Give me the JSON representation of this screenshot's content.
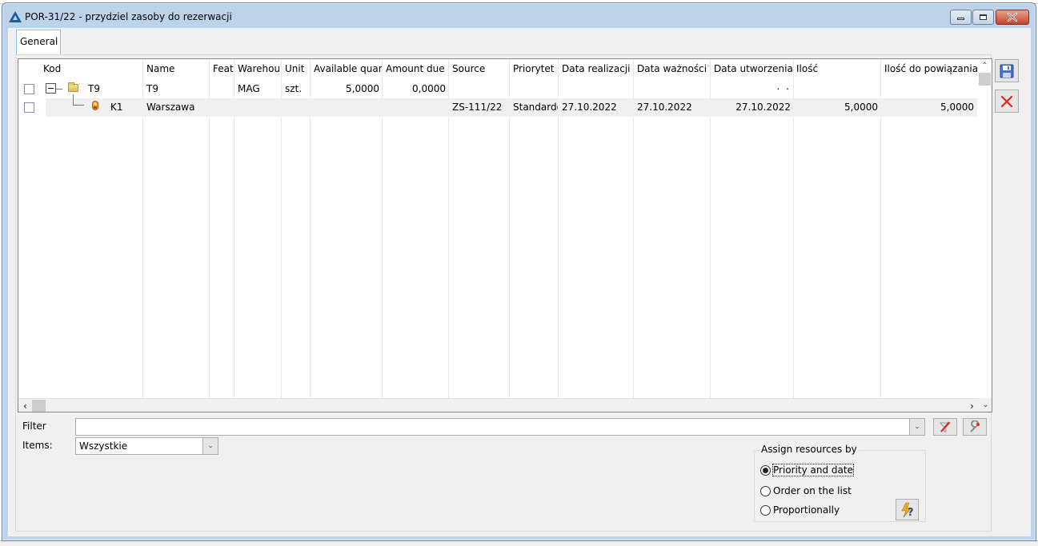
{
  "window": {
    "title": "POR-31/22 - przydziel zasoby do rezerwacji",
    "app_icon": "comarch-triangle-icon",
    "controls": [
      "minimize",
      "maximize",
      "close"
    ]
  },
  "tabs": [
    {
      "label": "General",
      "active": true
    }
  ],
  "grid": {
    "columns": [
      {
        "key": "kod",
        "label": "Kod"
      },
      {
        "key": "name",
        "label": "Name"
      },
      {
        "key": "feat",
        "label": "Feat"
      },
      {
        "key": "warehouse",
        "label": "Warehou"
      },
      {
        "key": "unit",
        "label": "Unit"
      },
      {
        "key": "available",
        "label": "Available quan"
      },
      {
        "key": "amount_due",
        "label": "Amount due"
      },
      {
        "key": "source",
        "label": "Source"
      },
      {
        "key": "priority",
        "label": "Priorytet"
      },
      {
        "key": "data_realizacji",
        "label": "Data realizacji"
      },
      {
        "key": "data_waznosci",
        "label": "Data ważności"
      },
      {
        "key": "data_utworzenia",
        "label": "Data utworzenia"
      },
      {
        "key": "ilosc",
        "label": "Ilość"
      },
      {
        "key": "ilosc_do_powiazania",
        "label": "Ilość do powiązania"
      }
    ],
    "rows": [
      {
        "checked": false,
        "level": 0,
        "icon": "folder-icon",
        "expanded": true,
        "kod": "T9",
        "name": "T9",
        "feat": "",
        "warehouse": "MAG",
        "unit": "szt.",
        "available": "5,0000",
        "amount_due": "0,0000",
        "source": "",
        "priority": "",
        "data_realizacji": "",
        "data_waznosci": "",
        "data_utworzenia": ". .",
        "ilosc": "",
        "ilosc_do_powiazania": ""
      },
      {
        "checked": false,
        "level": 1,
        "icon": "customer-icon",
        "selected": true,
        "kod": "K1",
        "name": "Warszawa",
        "feat": "",
        "warehouse": "",
        "unit": "",
        "available": "",
        "amount_due": "",
        "source": "ZS-111/22",
        "priority": "Standardo",
        "data_realizacji": "27.10.2022",
        "data_waznosci": "27.10.2022",
        "data_utworzenia": "27.10.2022",
        "ilosc": "5,0000",
        "ilosc_do_powiazania": "5,0000"
      }
    ]
  },
  "filter": {
    "label": "Filter",
    "value": "",
    "placeholder": ""
  },
  "items": {
    "label": "Items:",
    "selected": "Wszystkie"
  },
  "filter_buttons": [
    {
      "name": "clear-filter",
      "icon": "funnel-strike-icon"
    },
    {
      "name": "filter-builder",
      "icon": "wrench-icon"
    }
  ],
  "assign": {
    "legend": "Assign resources by",
    "options": [
      {
        "label": "Priority and date",
        "selected": true
      },
      {
        "label": "Order on the list",
        "selected": false
      },
      {
        "label": "Proportionally",
        "selected": false
      }
    ],
    "run_button_icon": "lightning-question-icon"
  },
  "side_buttons": [
    {
      "name": "save",
      "icon": "floppy-disk-icon"
    },
    {
      "name": "cancel",
      "icon": "red-x-icon"
    }
  ]
}
